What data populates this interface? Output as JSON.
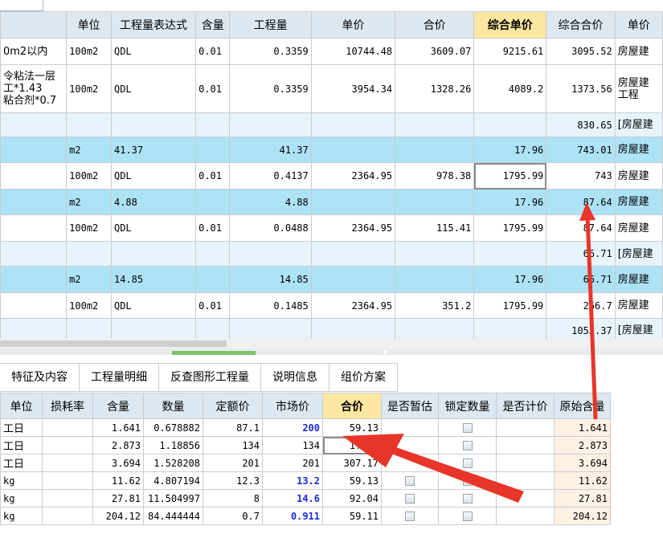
{
  "top_grid": {
    "headers": [
      "",
      "单位",
      "工程量表达式",
      "含量",
      "工程量",
      "单价",
      "合价",
      "综合单价",
      "综合合价",
      "单价"
    ],
    "rows": [
      {
        "style": "white",
        "name": "0m2以内",
        "unit": "100m2",
        "expr": "QDL",
        "content": "0.01",
        "qty": "0.3359",
        "price": "10744.48",
        "total": "3609.07",
        "comp_price": "9215.61",
        "comp_total": "3095.52",
        "category": "房屋建"
      },
      {
        "style": "white",
        "name": "令粘法一层\n工*1.43\n粘合剂*0.7",
        "unit": "100m2",
        "expr": "QDL",
        "content": "0.01",
        "qty": "0.3359",
        "price": "3954.34",
        "total": "1328.26",
        "comp_price": "4089.2",
        "comp_total": "1373.56",
        "category": "房屋建\n工程"
      },
      {
        "style": "light",
        "name": "",
        "unit": "",
        "expr": "",
        "content": "",
        "qty": "",
        "price": "",
        "total": "",
        "comp_price": "",
        "comp_total": "830.65",
        "category": "[房屋建"
      },
      {
        "style": "blue",
        "name": "",
        "unit": "m2",
        "expr": "41.37",
        "content": "",
        "qty": "41.37",
        "price": "",
        "total": "",
        "comp_price": "17.96",
        "comp_total": "743.01",
        "category": "房屋建"
      },
      {
        "style": "white",
        "name": "",
        "unit": "100m2",
        "expr": "QDL",
        "content": "0.01",
        "qty": "0.4137",
        "price": "2364.95",
        "total": "978.38",
        "comp_price": "1795.99",
        "comp_total": "743",
        "category": "房屋建"
      },
      {
        "style": "blue",
        "name": "",
        "unit": "m2",
        "expr": "4.88",
        "content": "",
        "qty": "4.88",
        "price": "",
        "total": "",
        "comp_price": "17.96",
        "comp_total": "87.64",
        "category": "房屋建"
      },
      {
        "style": "white",
        "name": "",
        "unit": "100m2",
        "expr": "QDL",
        "content": "0.01",
        "qty": "0.0488",
        "price": "2364.95",
        "total": "115.41",
        "comp_price": "1795.99",
        "comp_total": "87.64",
        "category": "房屋建"
      },
      {
        "style": "light",
        "name": "",
        "unit": "",
        "expr": "",
        "content": "",
        "qty": "",
        "price": "",
        "total": "",
        "comp_price": "",
        "comp_total": "66.71",
        "category": "[房屋建"
      },
      {
        "style": "blue",
        "name": "",
        "unit": "m2",
        "expr": "14.85",
        "content": "",
        "qty": "14.85",
        "price": "",
        "total": "",
        "comp_price": "17.96",
        "comp_total": "66.71",
        "category": "房屋建"
      },
      {
        "style": "white",
        "name": "",
        "unit": "100m2",
        "expr": "QDL",
        "content": "0.01",
        "qty": "0.1485",
        "price": "2364.95",
        "total": "351.2",
        "comp_price": "1795.99",
        "comp_total": "266.7",
        "category": "房屋建"
      },
      {
        "style": "light",
        "name": "",
        "unit": "",
        "expr": "",
        "content": "",
        "qty": "",
        "price": "",
        "total": "",
        "comp_price": "",
        "comp_total": "1052.37",
        "category": "[房屋建"
      }
    ]
  },
  "bottom_tabs": [
    "特征及内容",
    "工程量明细",
    "反查图形工程量",
    "说明信息",
    "组价方案"
  ],
  "bottom_grid": {
    "headers": [
      "单位",
      "损耗率",
      "含量",
      "数量",
      "定额价",
      "市场价",
      "合价",
      "是否暂估",
      "锁定数量",
      "是否计价",
      "原始含量"
    ],
    "rows": [
      {
        "unit": "工日",
        "loss": "",
        "content": "1.641",
        "qty": "0.678882",
        "quota": "87.1",
        "market": "200",
        "market_blue": true,
        "total": "59.13",
        "est": false,
        "lock": true,
        "price_flag": false,
        "orig": "1.641"
      },
      {
        "unit": "工日",
        "loss": "",
        "content": "2.873",
        "qty": "1.18856",
        "quota": "134",
        "market": "134",
        "market_blue": false,
        "total": "1?.27",
        "est": false,
        "lock": true,
        "price_flag": false,
        "orig": "2.873"
      },
      {
        "unit": "工日",
        "loss": "",
        "content": "3.694",
        "qty": "1.528208",
        "quota": "201",
        "market": "201",
        "market_blue": false,
        "total": "307.17",
        "est": false,
        "lock": true,
        "price_flag": false,
        "orig": "3.694"
      },
      {
        "unit": "kg",
        "loss": "",
        "content": "11.62",
        "qty": "4.807194",
        "quota": "12.3",
        "market": "13.2",
        "market_blue": true,
        "total": "59.13",
        "est": true,
        "lock": true,
        "price_flag": false,
        "orig": "11.62"
      },
      {
        "unit": "kg",
        "loss": "",
        "content": "27.81",
        "qty": "11.504997",
        "quota": "8",
        "market": "14.6",
        "market_blue": true,
        "total": "92.04",
        "est": true,
        "lock": true,
        "price_flag": false,
        "orig": "27.81"
      },
      {
        "unit": "kg",
        "loss": "",
        "content": "204.12",
        "qty": "84.444444",
        "quota": "0.7",
        "market": "0.911",
        "market_blue": true,
        "total": "59.11",
        "est": true,
        "lock": true,
        "price_flag": false,
        "orig": "204.12"
      }
    ]
  },
  "colors": {
    "annotation_arrow": "#e8352a",
    "highlight_header": "#fbe7a0",
    "row_blue": "#aee2f5",
    "market_value": "#1a2bd8"
  }
}
